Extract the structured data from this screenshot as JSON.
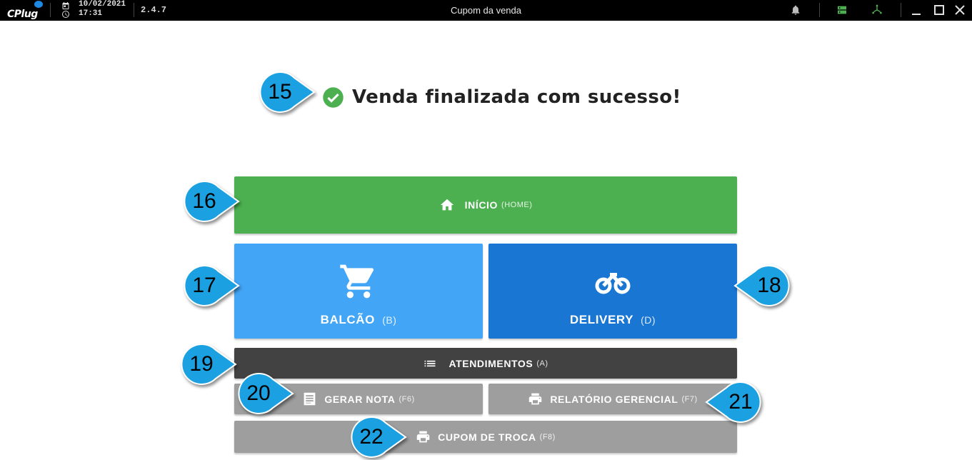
{
  "titlebar": {
    "logo": "CPlug",
    "date": "10/02/2021",
    "time": "17:31",
    "version": "2.4.7",
    "window_title": "Cupom da venda",
    "icons": [
      "bell-icon",
      "server-icon",
      "network-icon",
      "minimize-icon",
      "maximize-icon",
      "close-icon"
    ]
  },
  "success": {
    "message": "Venda finalizada com sucesso!",
    "icon": "check-circle-icon"
  },
  "buttons": {
    "home": {
      "label": "INÍCIO",
      "key": "(HOME)",
      "icon": "home-icon"
    },
    "balcao": {
      "label": "BALCÃO",
      "key": "(B)",
      "icon": "cart-icon"
    },
    "delivery": {
      "label": "DELIVERY",
      "key": "(D)",
      "icon": "motorcycle-icon"
    },
    "atend": {
      "label": "ATENDIMENTOS",
      "key": "(A)",
      "icon": "list-icon"
    },
    "nota": {
      "label": "GERAR NOTA",
      "key": "(F6)",
      "icon": "receipt-icon"
    },
    "relatorio": {
      "label": "RELATÓRIO GERENCIAL",
      "key": "(F7)",
      "icon": "printer-icon"
    },
    "troca": {
      "label": "CUPOM DE TROCA",
      "key": "(F8)",
      "icon": "printer-icon"
    }
  },
  "callouts": [
    "15",
    "16",
    "17",
    "18",
    "19",
    "20",
    "21",
    "22"
  ],
  "colors": {
    "home": "#4caf50",
    "balcao": "#42a5f5",
    "delivery": "#1976d2",
    "atendimentos": "#424242",
    "secondary": "#9e9e9e",
    "callout": "#1ba1e2",
    "success": "#4caf50"
  }
}
